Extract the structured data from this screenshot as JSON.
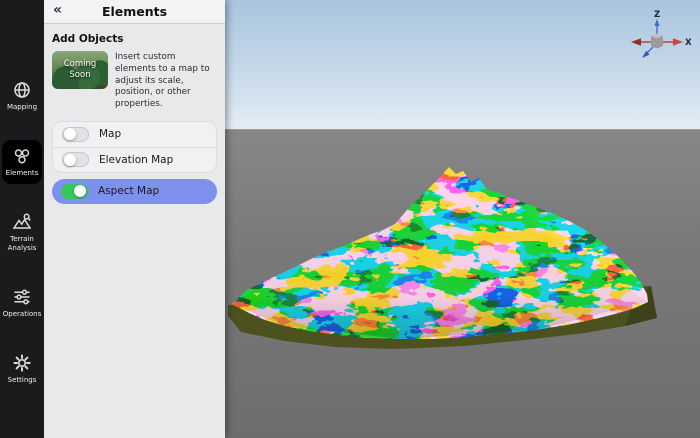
{
  "sidebar": {
    "items": [
      {
        "label": "Mapping",
        "icon": "globe-icon",
        "active": false
      },
      {
        "label": "Elements",
        "icon": "elements-icon",
        "active": true
      },
      {
        "label": "Terrain Analysis",
        "icon": "terrain-analysis-icon",
        "active": false
      },
      {
        "label": "Operations",
        "icon": "operations-icon",
        "active": false
      },
      {
        "label": "Settings",
        "icon": "gear-icon",
        "active": false
      }
    ]
  },
  "panel": {
    "collapse_icon": "«",
    "title": "Elements",
    "section_title": "Add Objects",
    "thumbnail_label": "Coming Soon",
    "description": "Insert custom elements to a map to adjust its scale, position, or other properties.",
    "toggles": [
      {
        "label": "Map",
        "on": false,
        "selected": false
      },
      {
        "label": "Elevation Map",
        "on": false,
        "selected": false
      },
      {
        "label": "Aspect Map",
        "on": true,
        "selected": true
      }
    ]
  },
  "viewport": {
    "gizmo": {
      "z_label": "Z",
      "x_label": "X"
    }
  },
  "colors": {
    "sidebar_bg": "#1b1b1d",
    "sidebar_active": "#000000",
    "panel_bg": "#e9e9ec",
    "selection": "#7e90ee",
    "toggle_on": "#34c759",
    "axis_x": "#c04040",
    "axis_z": "#3b6fd4",
    "terrain_base": "#4c511f",
    "aspect_palette": [
      "#ff6a33",
      "#ffd633",
      "#33e0e8",
      "#2f6fe4",
      "#e8334d"
    ]
  }
}
